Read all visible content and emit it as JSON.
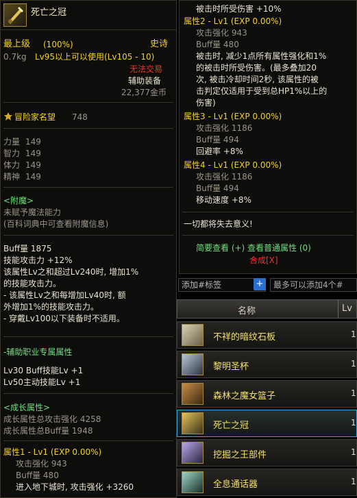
{
  "item": {
    "name": "死亡之冠",
    "grade": "最上级",
    "grade_pct": "(100%)",
    "rarity": "史诗",
    "weight": "0.7kg",
    "level_req": "Lv95以上可以使用(Lv105 - 10)",
    "trade": "无法交易",
    "type": "辅助装备",
    "price": "22,377金币",
    "fame_label": "冒险家名望",
    "fame_value": "748",
    "stats": [
      {
        "label": "力量",
        "value": "149"
      },
      {
        "label": "智力",
        "value": "149"
      },
      {
        "label": "体力",
        "value": "149"
      },
      {
        "label": "精神",
        "value": "149"
      }
    ],
    "enchant_title": "<附魔>",
    "enchant_none": "未赋予魔法能力",
    "enchant_hint": "(百科词典中可查看附魔信息)",
    "buff_line": "Buff量 1875",
    "skill_atk_line": "技能攻击力 +12%",
    "desc_lines": [
      "该属性Lv之和超过Lv240时, 增加1%",
      "的技能攻击力。",
      "- 该属性Lv之和每增加Lv40时, 额",
      "外增加1%的技能攻击力。",
      "- 穿戴Lv100以下装备时不适用。"
    ],
    "job_title": "-辅助职业专属属性",
    "job_lines": [
      "Lv30 Buff技能Lv +1",
      "Lv50主动技能Lv +1"
    ],
    "growth_title": "<成长属性>",
    "growth_lines": [
      "成长属性总攻击强化 4258",
      "成长属性总Buff量 1948"
    ],
    "attr1_title": "属性1 - Lv1 (EXP 0.00%)",
    "attr1_lines": [
      "攻击强化 943",
      "Buff量 480",
      "进入地下城时, 攻击强化 +3260"
    ]
  },
  "right": {
    "top_line": "被击时所受伤害 +10%",
    "attr2_title": "属性2 - Lv1 (EXP 0.00%)",
    "attr2_lines": [
      "攻击强化 943",
      "Buff量 480"
    ],
    "attr2_desc": [
      "被击时, 减少1点所有属性强化和1%",
      "的被击时所受伤害。(最多叠加20",
      "次, 被击冷却时间2秒, 该属性的被",
      "击判定仅适用于受到总HP1%以上的",
      "伤害)"
    ],
    "attr3_title": "属性3 - Lv1 (EXP 0.00%)",
    "attr3_lines": [
      "攻击强化 1186",
      "Buff量 494",
      "回避率 +8%"
    ],
    "attr4_title": "属性4 - Lv1 (EXP 0.00%)",
    "attr4_lines": [
      "攻击强化 1186",
      "Buff量 494",
      "移动速度 +8%"
    ],
    "quote": "一切都将失去意义!",
    "summary_link": "简要查看 (+) 查看普通属性 (0)",
    "combine_link": "合成[X]"
  },
  "list": {
    "tag_placeholder": "添加#标签",
    "plus_label": "+",
    "tag_hint": "最多可以添加4个#",
    "col_name": "名称",
    "col_lv": "Lv",
    "rows": [
      {
        "name": "不祥的暗纹石板",
        "lv": "1"
      },
      {
        "name": "黎明圣杯",
        "lv": "1"
      },
      {
        "name": "森林之魔女篮子",
        "lv": "1"
      },
      {
        "name": "死亡之冠",
        "lv": "1"
      },
      {
        "name": "挖掘之王部件",
        "lv": "1"
      },
      {
        "name": "全息通话器",
        "lv": "1"
      }
    ]
  }
}
